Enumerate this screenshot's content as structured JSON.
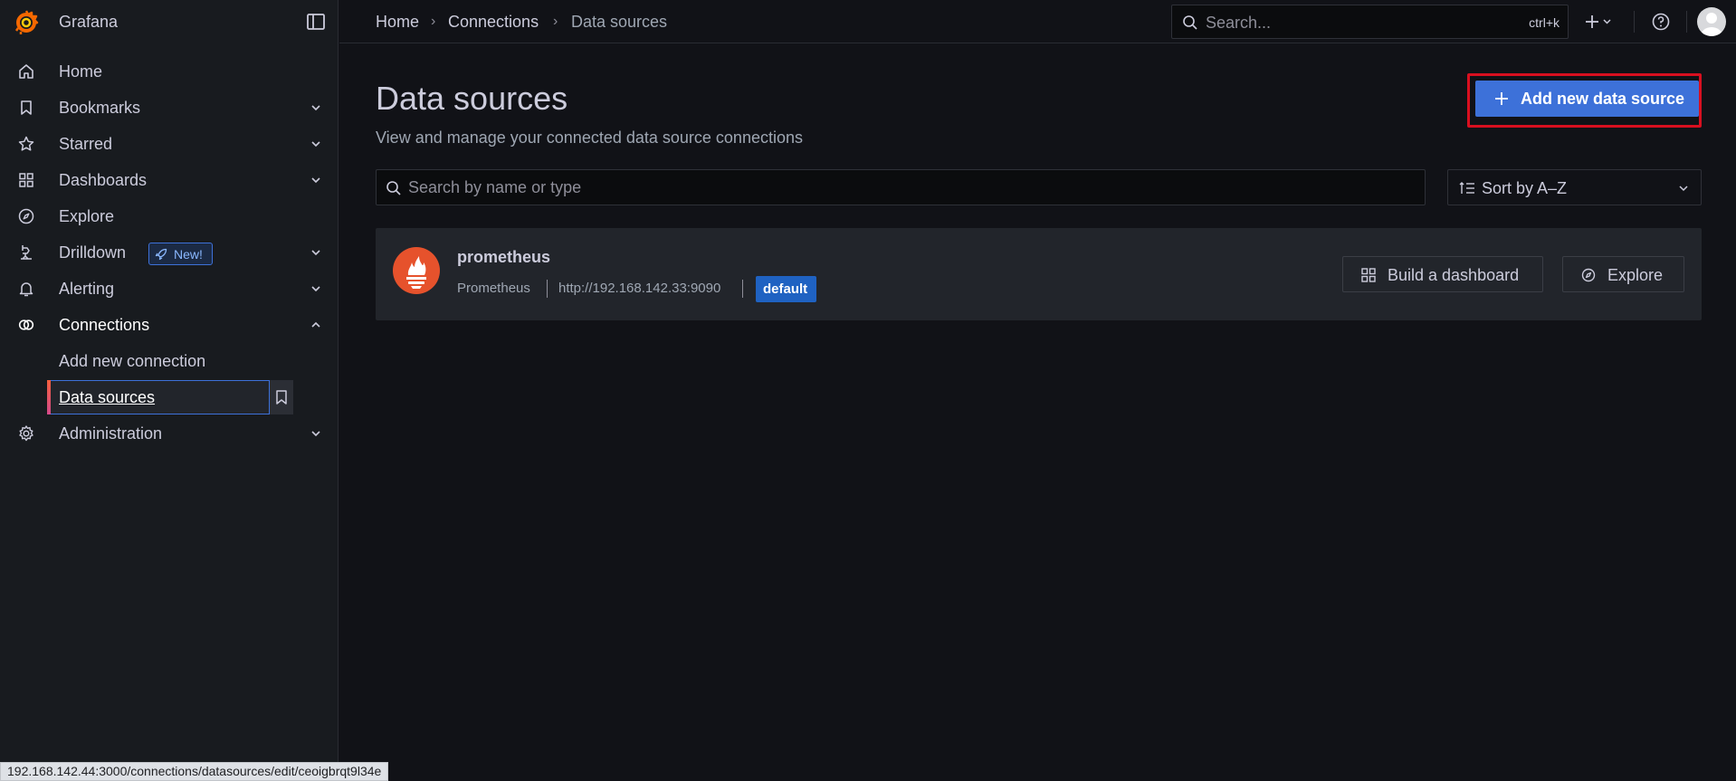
{
  "app": {
    "name": "Grafana"
  },
  "sidebar": {
    "items": [
      {
        "label": "Home",
        "icon": "home-icon"
      },
      {
        "label": "Bookmarks",
        "icon": "bookmark-icon"
      },
      {
        "label": "Starred",
        "icon": "star-icon"
      },
      {
        "label": "Dashboards",
        "icon": "apps-icon"
      },
      {
        "label": "Explore",
        "icon": "compass-icon"
      },
      {
        "label": "Drilldown",
        "icon": "drilldown-icon",
        "badge": "New!"
      },
      {
        "label": "Alerting",
        "icon": "bell-icon"
      },
      {
        "label": "Connections",
        "icon": "connections-icon",
        "expanded": true
      },
      {
        "label": "Administration",
        "icon": "gear-icon"
      }
    ],
    "connections_children": [
      {
        "label": "Add new connection"
      },
      {
        "label": "Data sources",
        "active": true
      }
    ]
  },
  "breadcrumb": {
    "home": "Home",
    "connections": "Connections",
    "current": "Data sources"
  },
  "topbar": {
    "search_placeholder": "Search...",
    "shortcut": "ctrl+k"
  },
  "page": {
    "title": "Data sources",
    "subtitle": "View and manage your connected data source connections",
    "add_button": "Add new data source",
    "search_placeholder": "Search by name or type",
    "sort_label": "Sort by A–Z"
  },
  "datasources": [
    {
      "name": "prometheus",
      "type": "Prometheus",
      "url": "http://192.168.142.33:9090",
      "badge": "default",
      "actions": {
        "build": "Build a dashboard",
        "explore": "Explore"
      }
    }
  ],
  "statusbar": {
    "url": "192.168.142.44:3000/connections/datasources/edit/ceoigbrqt9l34e"
  },
  "colors": {
    "accent": "#3d71d9",
    "highlight_frame": "#d90f1f",
    "prometheus": "#e6522c"
  }
}
